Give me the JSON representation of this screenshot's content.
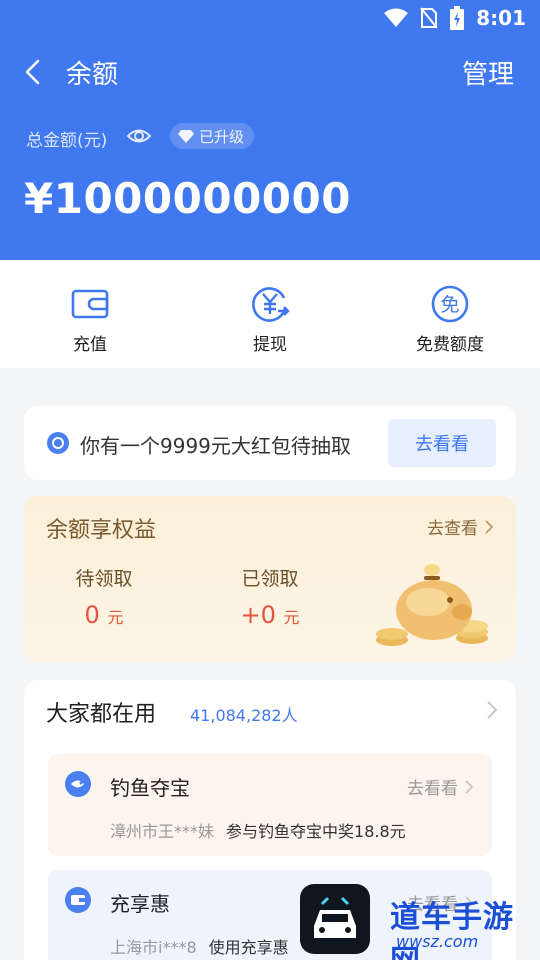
{
  "status_bar": {
    "time": "8:01",
    "icons": [
      "wifi-icon",
      "no-sim-icon",
      "battery-charging-icon"
    ]
  },
  "header": {
    "title": "余额",
    "manage_label": "管理",
    "total_label": "总金额(元)",
    "upgrade_badge": "已升级",
    "balance": "¥1000000000"
  },
  "actions": [
    {
      "label": "充值",
      "icon": "wallet-icon"
    },
    {
      "label": "提现",
      "icon": "yuan-withdraw-icon"
    },
    {
      "label": "免费额度",
      "icon": "free-quota-icon"
    }
  ],
  "red_packet": {
    "text": "你有一个9999元大红包待抽取",
    "button": "去看看"
  },
  "benefits": {
    "title": "余额享权益",
    "link": "去查看",
    "pending": {
      "label": "待领取",
      "value": "0",
      "unit": "元"
    },
    "claimed": {
      "label": "已领取",
      "value": "+0",
      "unit": "元"
    }
  },
  "popular": {
    "title": "大家都在用",
    "count": "41,084,282人",
    "items": [
      {
        "name": "钓鱼夺宝",
        "link": "去看看",
        "user": "漳州市王***妹",
        "detail": "参与钓鱼夺宝中奖18.8元",
        "icon": "fishing-icon"
      },
      {
        "name": "充享惠",
        "link": "去看看",
        "user": "上海市i***8",
        "detail": "使用充享惠",
        "icon": "card-icon"
      }
    ]
  },
  "watermark": {
    "text": "道车手游网",
    "url": "wwsz.com"
  },
  "colors": {
    "primary": "#3f78ef",
    "accent_red": "#e6533c",
    "gold_text": "#7a5a2e"
  }
}
